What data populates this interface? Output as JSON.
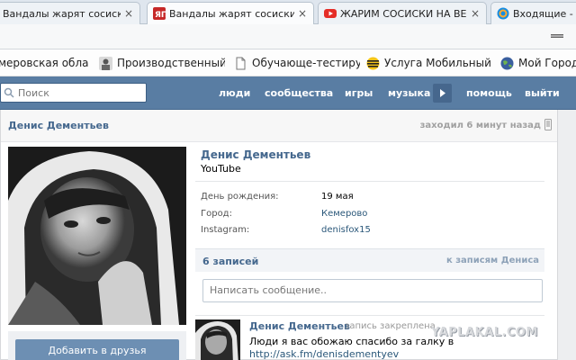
{
  "browser": {
    "tabs": [
      {
        "title": "Вандалы жарят сосиски в",
        "favicon": "yaplakal-favicon",
        "active": false
      },
      {
        "title": "Вандалы жарят сосиски в",
        "favicon": "yaplakal-favicon",
        "active": true
      },
      {
        "title": "ЖАРИМ СОСИСКИ НА ВЕ",
        "favicon": "youtube-favicon",
        "active": false
      },
      {
        "title": "Входящие -",
        "favicon": "mail-favicon",
        "active": false
      }
    ],
    "close_glyph": "×"
  },
  "bookmarks": [
    {
      "label": "меровская област",
      "icon": "globe-icon"
    },
    {
      "label": "Производственный к",
      "icon": "avatar-icon"
    },
    {
      "label": "Обучающе-тестирующ",
      "icon": "page-icon"
    },
    {
      "label": "Услуга Мобильный п",
      "icon": "beeline-icon"
    },
    {
      "label": "Мой Город",
      "icon": "globe-icon"
    }
  ],
  "vk_header": {
    "search_placeholder": "Поиск",
    "nav": [
      "люди",
      "сообщества",
      "игры",
      "музыка",
      "помощь",
      "выйти"
    ]
  },
  "profile": {
    "name_bar": "Денис Дементьев",
    "last_seen": "заходил 6 минут назад",
    "name": "Денис Дементьев",
    "status": "YouTube",
    "info": [
      {
        "label": "День рождения:",
        "value": "19 мая",
        "link": false
      },
      {
        "label": "Город:",
        "value": "Кемерово",
        "link": true
      },
      {
        "label": "Instagram:",
        "value": "denisfox15",
        "link": true
      }
    ],
    "add_friend": "Добавить в друзья"
  },
  "wall": {
    "count": "6 записей",
    "to_posts": "к записям Дениса",
    "compose_placeholder": "Написать сообщение..",
    "post": {
      "author": "Денис Дементьев",
      "note": "запись закреплена",
      "text": "Люди я вас обожаю спасибо за галку в",
      "link": "http://ask.fm/denisdementyev"
    }
  },
  "watermark": "YAPLAKAL.COM",
  "colors": {
    "vk_blue": "#597da3",
    "vk_link": "#45688e",
    "button_blue": "#6d8fb3"
  }
}
